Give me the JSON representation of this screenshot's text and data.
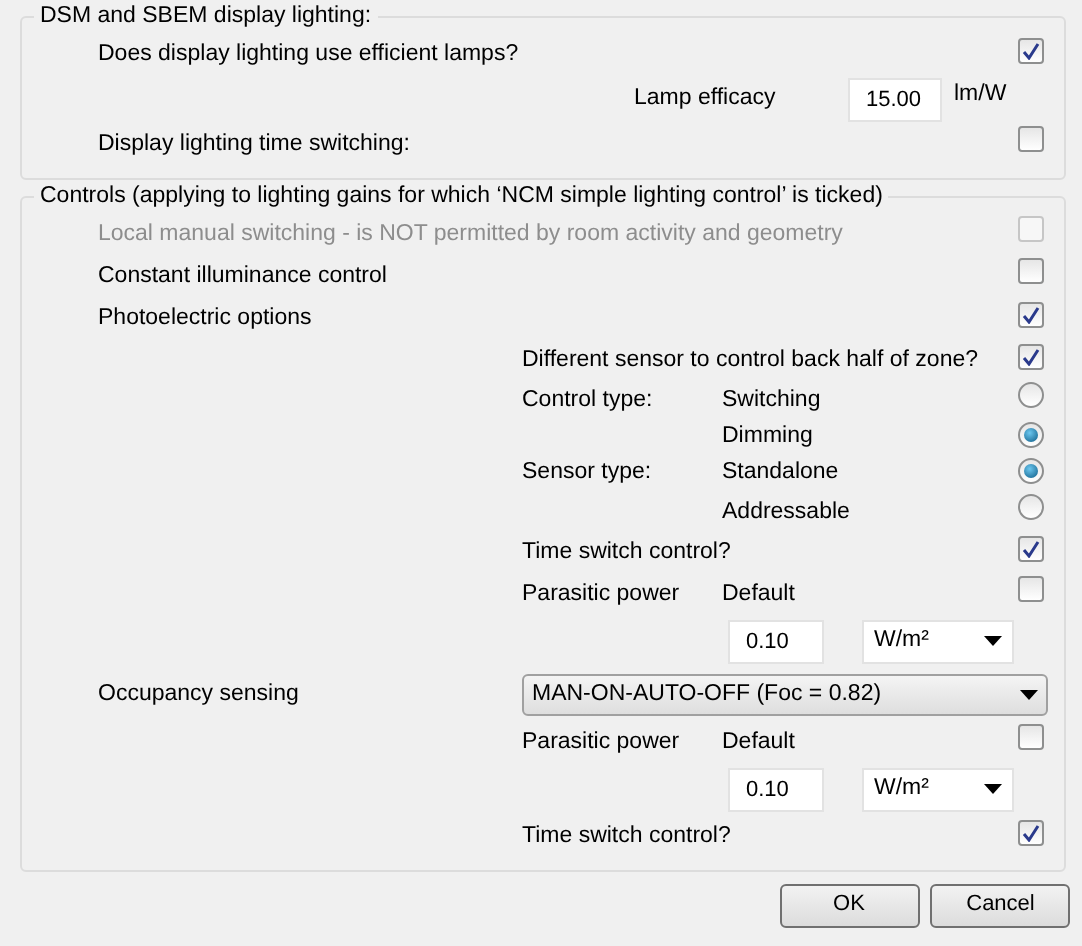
{
  "sections": [
    {
      "title": "DSM and SBEM display lighting:",
      "rows": [
        {
          "kind": "check",
          "label": "Does display lighting use efficient lamps?",
          "checked": true,
          "disabled": false
        },
        {
          "kind": "field",
          "label": "Lamp efficacy",
          "value": "15.00",
          "unit": "lm/W"
        },
        {
          "kind": "check",
          "label": "Display lighting time switching:",
          "checked": false,
          "disabled": false
        }
      ]
    },
    {
      "title": "Controls (applying to lighting gains for which ‘NCM simple lighting control’ is ticked)",
      "rows": [
        {
          "kind": "check",
          "label": "Local manual switching - is NOT permitted by room activity and geometry",
          "checked": false,
          "disabled": true
        },
        {
          "kind": "check",
          "label": "Constant illuminance control",
          "checked": false,
          "disabled": false
        },
        {
          "kind": "check",
          "label": "Photoelectric options",
          "checked": true,
          "disabled": false
        },
        {
          "kind": "subcheck",
          "label": "Different sensor to control back half of zone?",
          "checked": true,
          "disabled": false
        },
        {
          "kind": "radio",
          "label": "Control type:",
          "options": [
            {
              "label": "Switching",
              "selected": false
            },
            {
              "label": "Dimming",
              "selected": true
            }
          ]
        },
        {
          "kind": "radio",
          "label": "Sensor type:",
          "options": [
            {
              "label": "Standalone",
              "selected": true
            },
            {
              "label": "Addressable",
              "selected": false
            }
          ]
        },
        {
          "kind": "subcheck",
          "label": "Time switch control?",
          "checked": true,
          "disabled": false
        },
        {
          "kind": "parasitic",
          "label": "Parasitic power",
          "default_label": "Default",
          "default_checked": false
        },
        {
          "kind": "quantity",
          "value": "0.10",
          "unit": "W/m²"
        },
        {
          "kind": "select",
          "label": "Occupancy sensing",
          "value": "MAN-ON-AUTO-OFF (Foc = 0.82)"
        },
        {
          "kind": "parasitic",
          "label": "Parasitic power",
          "default_label": "Default",
          "default_checked": false
        },
        {
          "kind": "quantity",
          "value": "0.10",
          "unit": "W/m²"
        },
        {
          "kind": "subcheck",
          "label": "Time switch control?",
          "checked": true,
          "disabled": false
        }
      ]
    }
  ],
  "buttons": [
    "OK",
    "Cancel"
  ]
}
